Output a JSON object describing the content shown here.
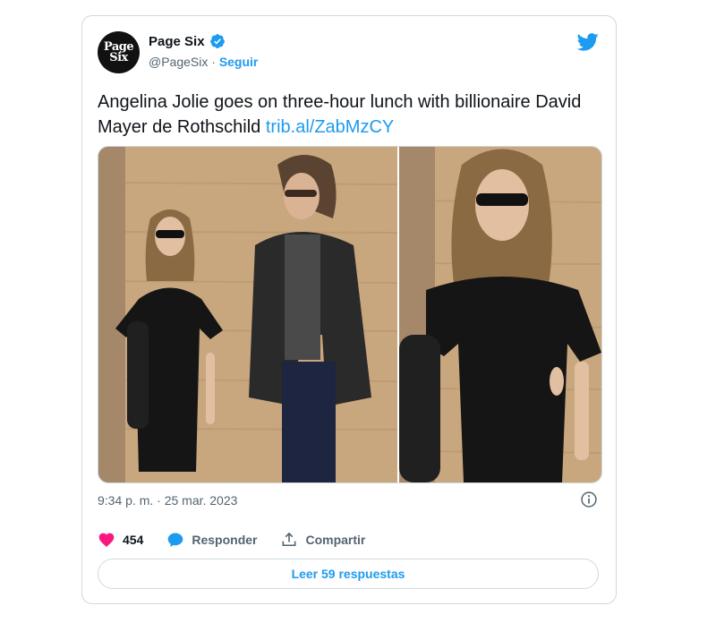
{
  "author": {
    "display_name": "Page Six",
    "handle": "@PageSix",
    "separator": "·",
    "follow_label": "Seguir",
    "avatar_line1": "Page",
    "avatar_line2": "Six"
  },
  "tweet": {
    "text": "Angelina Jolie goes on three-hour lunch with billionaire David Mayer de Rothschild ",
    "link": "trib.al/ZabMzCY",
    "timestamp": "9:34 p. m. · 25 mar. 2023"
  },
  "actions": {
    "like_count": "454",
    "reply_label": "Responder",
    "share_label": "Compartir"
  },
  "read_replies_label": "Leer 59 respuestas",
  "colors": {
    "accent": "#1d9bf0",
    "like": "#f91880",
    "border": "#cfd9de",
    "muted": "#536471"
  }
}
